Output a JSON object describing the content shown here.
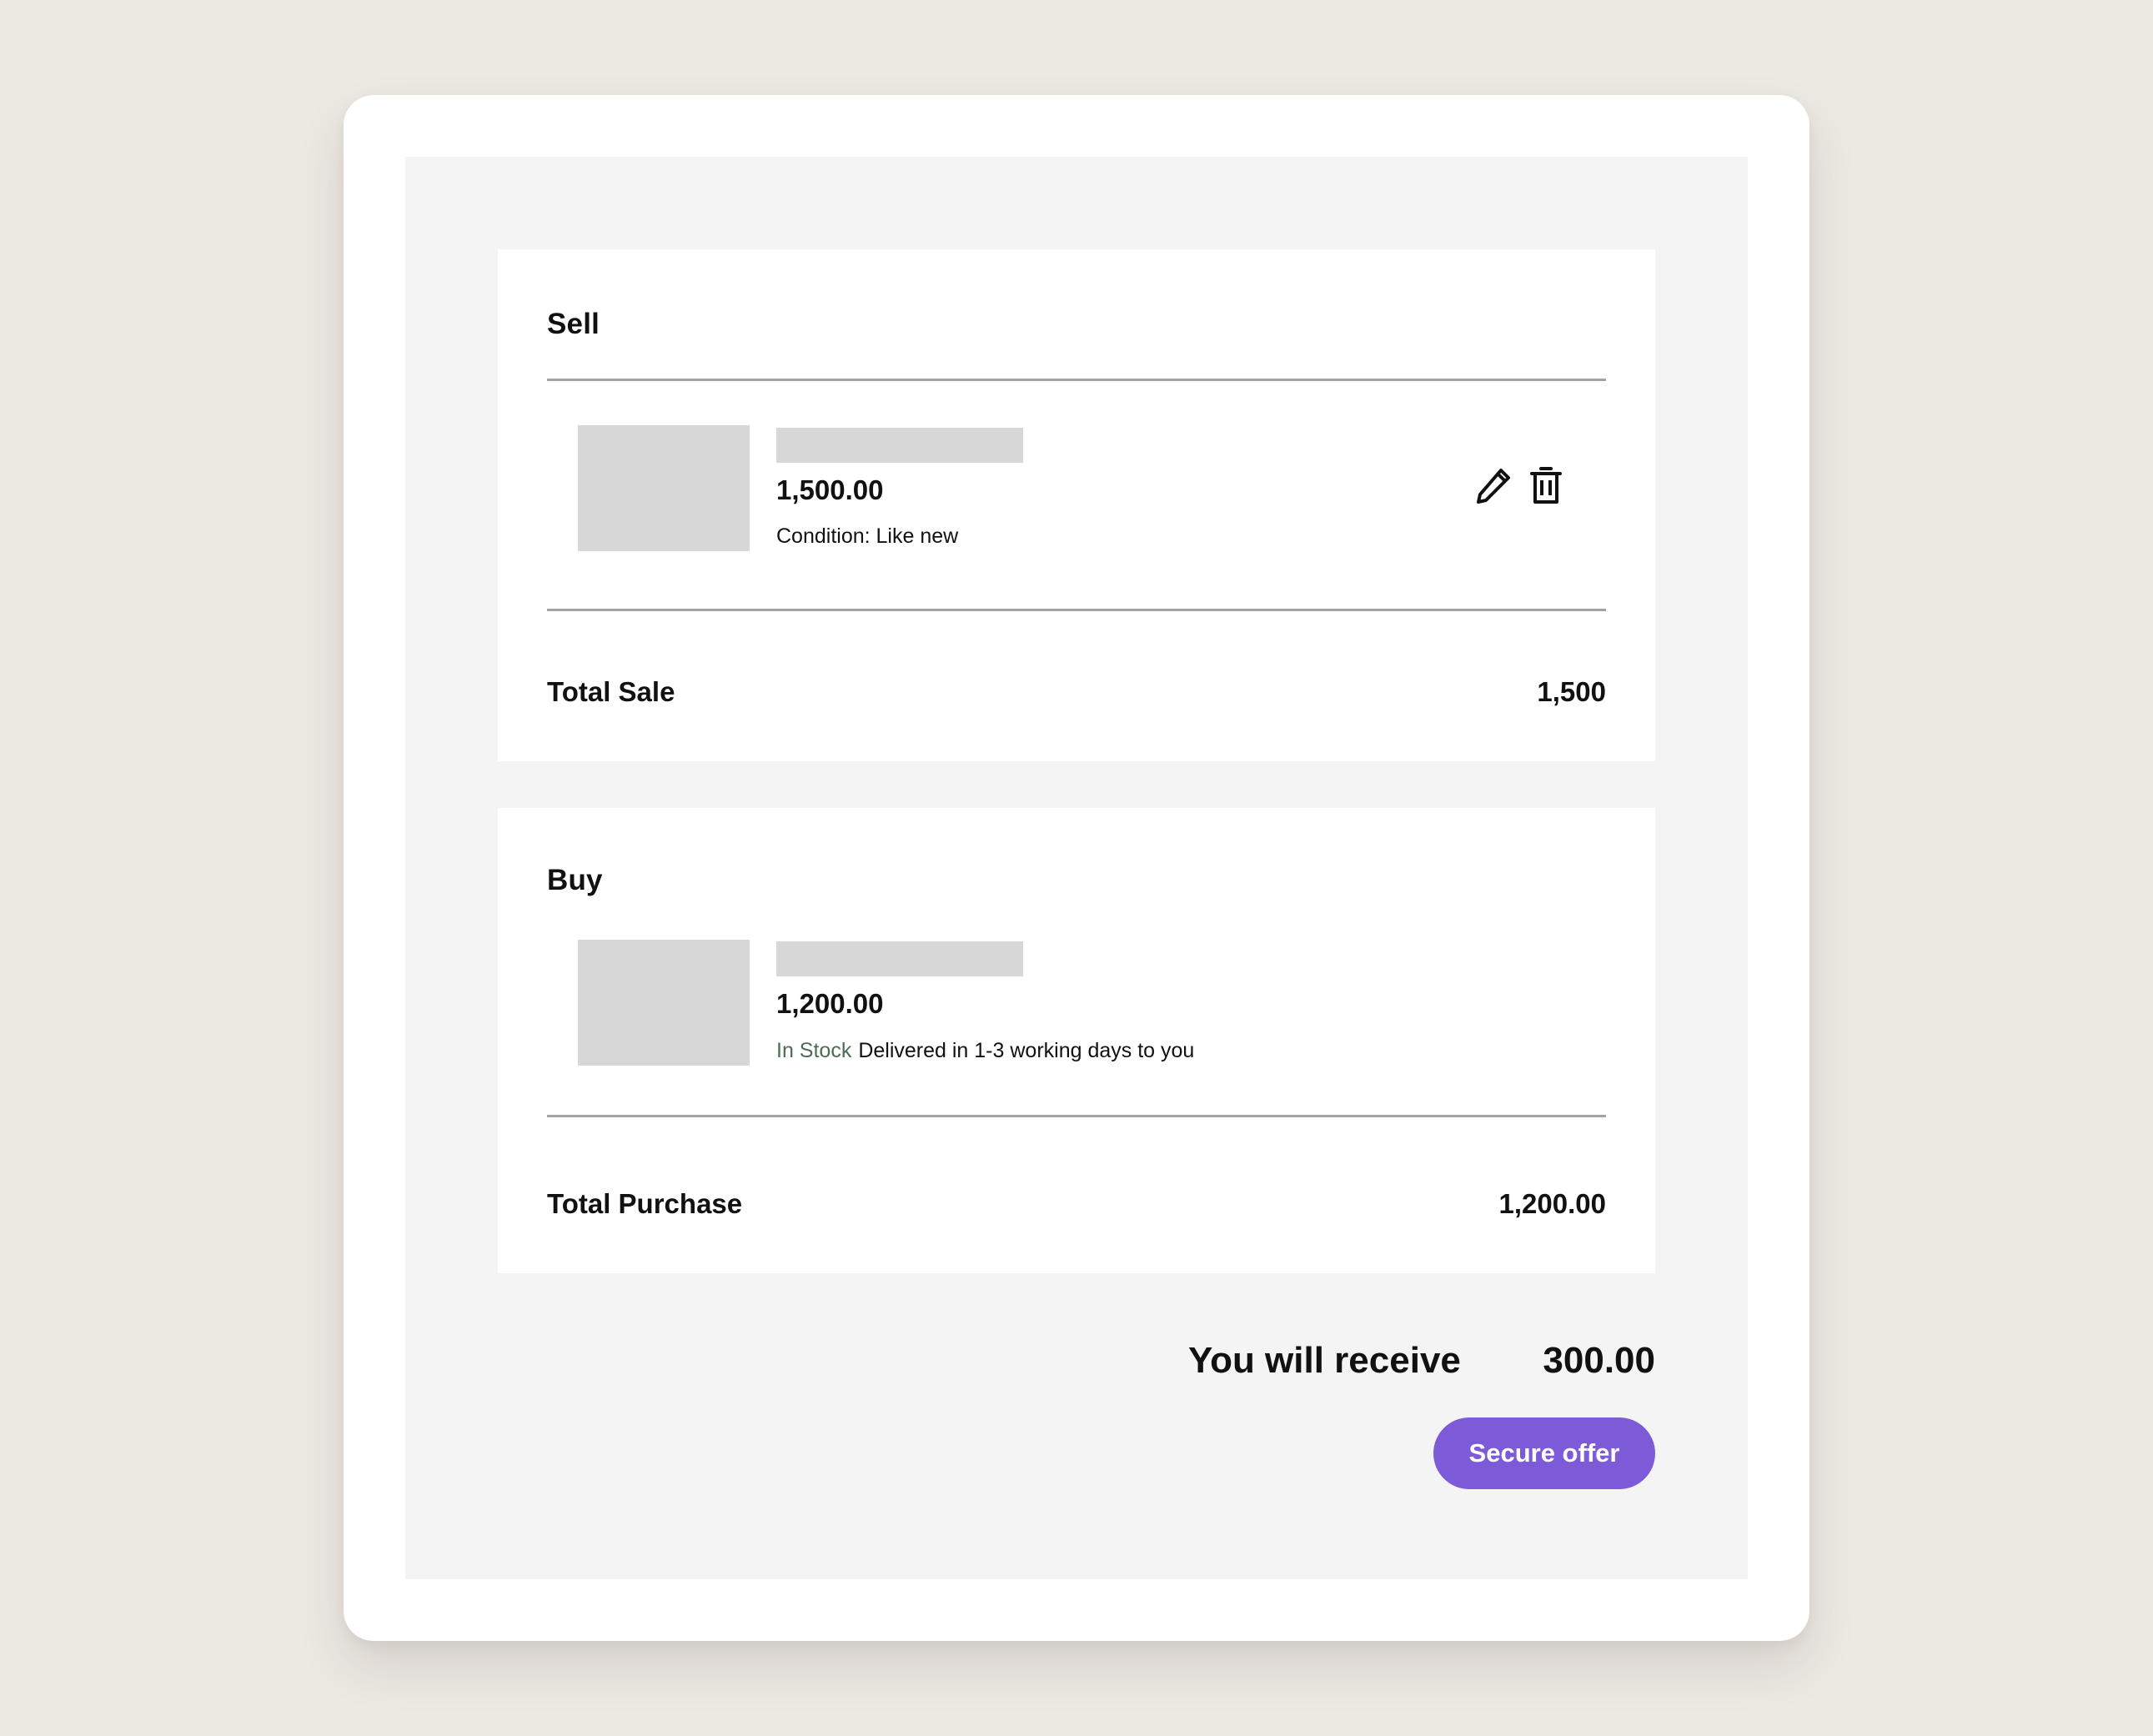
{
  "colors": {
    "accent": "#7d5ad8",
    "stock_green": "#4e6b55",
    "placeholder_gray": "#d7d7d7"
  },
  "sell": {
    "title": "Sell",
    "item": {
      "price": "1,500.00",
      "condition": "Condition: Like new",
      "edit_icon": "pencil-icon",
      "delete_icon": "trash-icon"
    },
    "total_label": "Total Sale",
    "total_value": "1,500"
  },
  "buy": {
    "title": "Buy",
    "item": {
      "price": "1,200.00",
      "stock_status": "In Stock",
      "delivery": "Delivered in 1-3 working days to you"
    },
    "total_label": "Total Purchase",
    "total_value": "1,200.00"
  },
  "summary": {
    "receive_label": "You will receive",
    "receive_value": "300.00",
    "cta_label": "Secure offer"
  }
}
